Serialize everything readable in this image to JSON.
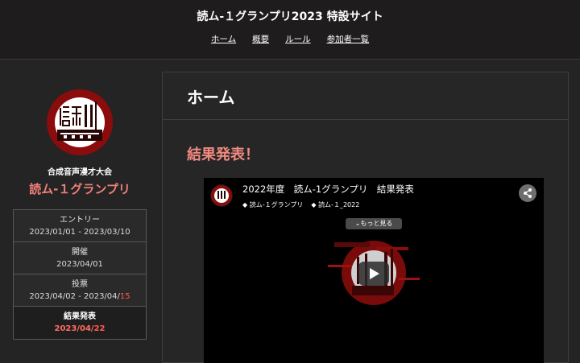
{
  "header": {
    "site_title": "読ム-１グランプリ2023 特設サイト",
    "nav": [
      "ホーム",
      "概要",
      "ルール",
      "参加者一覧"
    ]
  },
  "sidebar": {
    "organizer": "合成音声漫才大会",
    "event_name": "読ム-１グランプリ",
    "schedule": [
      {
        "label": "エントリー",
        "date": "2023/01/01 - 2023/03/10"
      },
      {
        "label": "開催",
        "date": "2023/04/01"
      },
      {
        "label": "投票",
        "date_prefix": "2023/04/02 - 2023/04/",
        "date_highlight": "15"
      },
      {
        "label": "結果発表",
        "date_prefix": "2023/04/",
        "date_highlight": "22"
      }
    ]
  },
  "main": {
    "page_title": "ホーム",
    "section_title": "結果発表！",
    "video": {
      "title": "2022年度　読ム-1グランプリ　結果発表",
      "tags": [
        "読ム-１グランプリ",
        "読ム-１_2022"
      ],
      "more_label": "⌄もっと見る"
    }
  },
  "colors": {
    "accent": "#f07f78",
    "highlight": "#ff5a4f",
    "background": "#242424"
  },
  "icons": [
    "logo-emblem",
    "share-icon",
    "play-icon",
    "tag-icon"
  ]
}
